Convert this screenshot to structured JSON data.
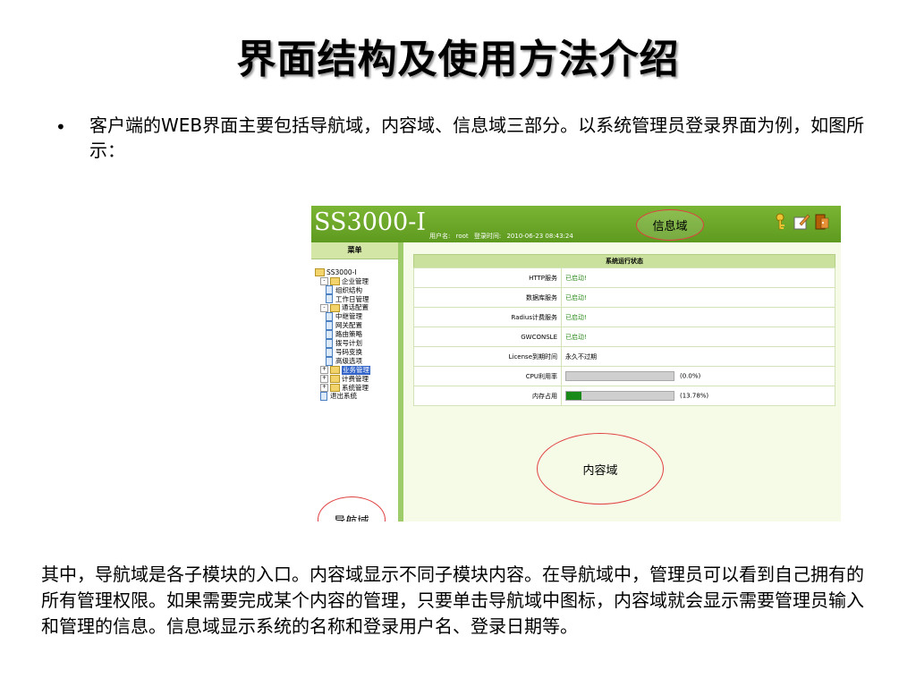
{
  "slide": {
    "title": "界面结构及使用方法介绍",
    "bullet_char": "•",
    "bullet": "客户端的WEB界面主要包括导航域，内容域、信息域三部分。以系统管理员登录界面为例，如图所示：",
    "summary": "其中，导航域是各子模块的入口。内容域显示不同子模块内容。在导航域中，管理员可以看到自己拥有的所有管理权限。如果需要完成某个内容的管理，只要单击导航域中图标，内容域就会显示需要管理员输入和管理的信息。信息域显示系统的名称和登录用户名、登录日期等。"
  },
  "app": {
    "brand": "SS3000-I",
    "user_label": "用户名:",
    "user_value": "root",
    "time_label": "登录时间:",
    "time_value": "2010-06-23 08:43:24",
    "header_icons": [
      "key-icon",
      "edit-note-icon",
      "exit-door-icon"
    ],
    "annotations": {
      "info": "信息域",
      "nav": "导航域",
      "content": "内容域"
    },
    "sidebar": {
      "title": "菜单",
      "tree": [
        {
          "label": "SS3000-I",
          "level": 0,
          "kind": "folder",
          "toggle": ""
        },
        {
          "label": "企业管理",
          "level": 1,
          "kind": "folder",
          "toggle": "-"
        },
        {
          "label": "组织结构",
          "level": 2,
          "kind": "page",
          "toggle": ""
        },
        {
          "label": "工作日管理",
          "level": 2,
          "kind": "page",
          "toggle": ""
        },
        {
          "label": "通话配置",
          "level": 1,
          "kind": "folder",
          "toggle": "-"
        },
        {
          "label": "中继管理",
          "level": 2,
          "kind": "page",
          "toggle": ""
        },
        {
          "label": "网关配置",
          "level": 2,
          "kind": "page",
          "toggle": ""
        },
        {
          "label": "路由策略",
          "level": 2,
          "kind": "page",
          "toggle": ""
        },
        {
          "label": "拨号计划",
          "level": 2,
          "kind": "page",
          "toggle": ""
        },
        {
          "label": "号码变换",
          "level": 2,
          "kind": "page",
          "toggle": ""
        },
        {
          "label": "高级选项",
          "level": 2,
          "kind": "page",
          "toggle": ""
        },
        {
          "label": "业务管理",
          "level": 1,
          "kind": "folder",
          "toggle": "+",
          "selected": true
        },
        {
          "label": "计费管理",
          "level": 1,
          "kind": "folder",
          "toggle": "+"
        },
        {
          "label": "系统管理",
          "level": 1,
          "kind": "folder",
          "toggle": "+"
        },
        {
          "label": "退出系统",
          "level": 1,
          "kind": "page",
          "toggle": ""
        }
      ]
    },
    "status": {
      "title": "系统运行状态",
      "rows": [
        {
          "key": "HTTP服务",
          "value": "已启动!",
          "kind": "ok"
        },
        {
          "key": "数据库服务",
          "value": "已启动!",
          "kind": "ok"
        },
        {
          "key": "Radius计费服务",
          "value": "已启动!",
          "kind": "ok"
        },
        {
          "key": "GWCONSLE",
          "value": "已启动!",
          "kind": "ok"
        },
        {
          "key": "License到期时间",
          "value": "永久不过期",
          "kind": "text"
        },
        {
          "key": "CPU利用率",
          "value": "(0.0%)",
          "kind": "bar",
          "percent": 0.0
        },
        {
          "key": "内存占用",
          "value": "(13.78%)",
          "kind": "bar",
          "percent": 13.78
        }
      ]
    }
  }
}
